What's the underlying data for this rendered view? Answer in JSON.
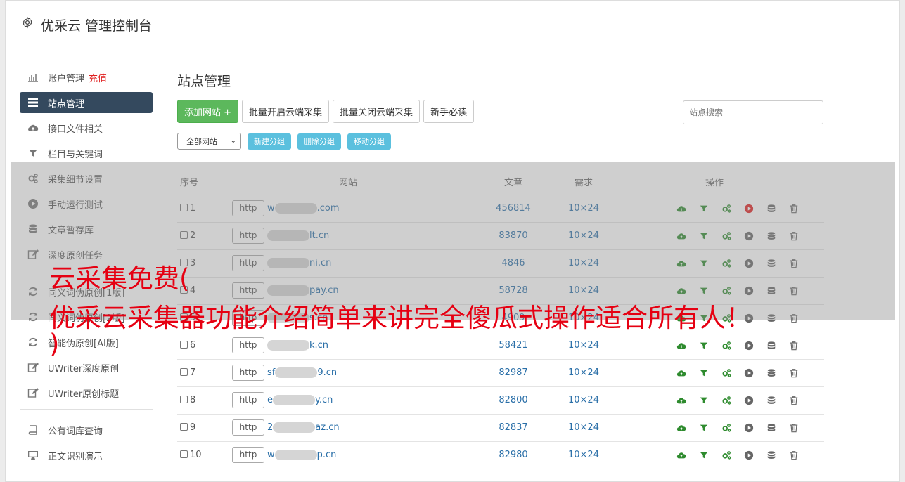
{
  "header": {
    "title": "优采云 管理控制台"
  },
  "sidebar": {
    "items": [
      {
        "label": "账户管理",
        "extra": "充值",
        "icon": "bar-chart-icon"
      },
      {
        "label": "站点管理",
        "icon": "server-icon",
        "active": true
      },
      {
        "label": "接口文件相关",
        "icon": "cloud-upload-icon"
      },
      {
        "label": "栏目与关键词",
        "icon": "filter-icon"
      },
      {
        "label": "采集细节设置",
        "icon": "gears-icon"
      },
      {
        "label": "手动运行测试",
        "icon": "play-circle-icon"
      },
      {
        "label": "文章暂存库",
        "icon": "database-icon"
      },
      {
        "label": "深度原创任务",
        "icon": "edit-icon"
      }
    ],
    "items2": [
      {
        "label": "同义词伪原创[1版]",
        "icon": "refresh-icon"
      },
      {
        "label": "同义词伪原创[2版]",
        "icon": "refresh-icon"
      },
      {
        "label": "智能伪原创[AI版]",
        "icon": "refresh-icon"
      },
      {
        "label": "UWriter深度原创",
        "icon": "edit-icon"
      },
      {
        "label": "UWriter原创标题",
        "icon": "edit-icon"
      }
    ],
    "items3": [
      {
        "label": "公有词库查询",
        "icon": "book-icon"
      },
      {
        "label": "正文识别演示",
        "icon": "desktop-icon"
      }
    ]
  },
  "main": {
    "title": "站点管理",
    "buttons": {
      "add": "添加网站 +",
      "batch_on": "批量开启云端采集",
      "batch_off": "批量关闭云端采集",
      "guide": "新手必读"
    },
    "search_placeholder": "站点搜索",
    "group_select": "全部网站",
    "group_buttons": {
      "new": "新建分组",
      "delete": "删除分组",
      "move": "移动分组"
    },
    "table": {
      "headers": [
        "序号",
        "网站",
        "文章",
        "需求",
        "操作"
      ],
      "rows": [
        {
          "no": "1",
          "proto": "http",
          "domain": "w",
          "domain_end": ".com",
          "articles": "456814",
          "need": "10×24",
          "run_active": true
        },
        {
          "no": "2",
          "proto": "http",
          "domain": "",
          "domain_end": "lt.cn",
          "articles": "83870",
          "need": "10×24"
        },
        {
          "no": "3",
          "proto": "http",
          "domain": "",
          "domain_end": "ni.cn",
          "articles": "4846",
          "need": "10×24"
        },
        {
          "no": "4",
          "proto": "http",
          "domain": "",
          "domain_end": "pay.cn",
          "articles": "58728",
          "need": "10×24"
        },
        {
          "no": "5",
          "proto": "http",
          "domain": "",
          "domain_end": "s.cn",
          "articles": "4909",
          "need": "10×24"
        },
        {
          "no": "6",
          "proto": "http",
          "domain": "",
          "domain_end": "k.cn",
          "articles": "58421",
          "need": "10×24"
        },
        {
          "no": "7",
          "proto": "http",
          "domain": "sf",
          "domain_end": "9.cn",
          "articles": "82987",
          "need": "10×24"
        },
        {
          "no": "8",
          "proto": "http",
          "domain": "e",
          "domain_end": "y.cn",
          "articles": "82800",
          "need": "10×24"
        },
        {
          "no": "9",
          "proto": "http",
          "domain": "2",
          "domain_end": "az.cn",
          "articles": "82837",
          "need": "10×24"
        },
        {
          "no": "10",
          "proto": "http",
          "domain": "w",
          "domain_end": "p.cn",
          "articles": "82980",
          "need": "10×24"
        }
      ]
    }
  },
  "overlay": {
    "headline_line1": "云采集免费(",
    "headline_line2": "优采云采集器功能介绍简单来讲完全傻瓜式操作适合所有人！",
    "headline_line3": ")"
  },
  "colors": {
    "active_nav": "#34495e",
    "green": "#5cb85c",
    "info": "#5bc0de",
    "headline": "#e60012",
    "link": "#2a6fa8"
  }
}
